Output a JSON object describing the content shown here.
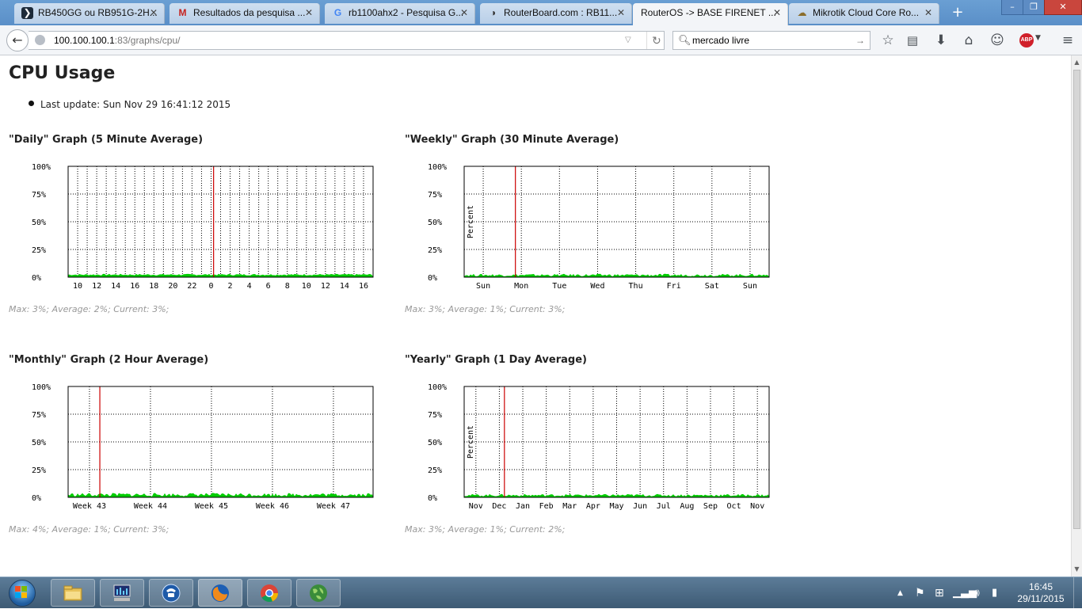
{
  "browser": {
    "tabs": [
      {
        "label": "RB450GG ou RB951G-2H...",
        "icon": "mikrotik-icon",
        "active": false
      },
      {
        "label": "Resultados da pesquisa ...",
        "icon": "gmail-icon",
        "active": false
      },
      {
        "label": "rb1100ahx2 - Pesquisa G...",
        "icon": "google-icon",
        "active": false
      },
      {
        "label": "RouterBoard.com : RB11...",
        "icon": "routerboard-icon",
        "active": false
      },
      {
        "label": "RouterOS -> BASE FIRENET ...",
        "icon": "",
        "active": true
      },
      {
        "label": "Mikrotik Cloud Core Ro...",
        "icon": "cloud-icon",
        "active": false
      }
    ],
    "url_host": "100.100.100.1",
    "url_path": ":83/graphs/cpu/",
    "search_value": "mercado livre",
    "abp_label": "ABP"
  },
  "page": {
    "title": "CPU Usage",
    "last_update": "Last update: Sun Nov 29 16:41:12 2015"
  },
  "graphs": [
    {
      "title": "\"Daily\" Graph (5 Minute Average)",
      "stats": "Max: 3%; Average: 2%; Current: 3%;",
      "ylabel": "",
      "chart_data": {
        "type": "area",
        "y_ticks": [
          "100%",
          "75%",
          "50%",
          "25%",
          "0%"
        ],
        "ylim": [
          0,
          100
        ],
        "x_labels": [
          "10",
          "12",
          "14",
          "16",
          "18",
          "20",
          "22",
          "0",
          "2",
          "4",
          "6",
          "8",
          "10",
          "12",
          "14",
          "16"
        ],
        "grid": true,
        "series_color": "#00cc00",
        "marker_color": "#cc0000",
        "marker_position": 0.477,
        "max": 3,
        "average": 2,
        "current": 3
      }
    },
    {
      "title": "\"Weekly\" Graph (30 Minute Average)",
      "stats": "Max: 3%; Average: 1%; Current: 3%;",
      "ylabel": "Percent",
      "chart_data": {
        "type": "area",
        "y_ticks": [
          "100%",
          "75%",
          "50%",
          "25%",
          "0%"
        ],
        "ylim": [
          0,
          100
        ],
        "x_labels": [
          "Sun",
          "Mon",
          "Tue",
          "Wed",
          "Thu",
          "Fri",
          "Sat",
          "Sun"
        ],
        "grid": true,
        "series_color": "#00cc00",
        "marker_color": "#cc0000",
        "marker_position": 0.168,
        "max": 3,
        "average": 1,
        "current": 3
      }
    },
    {
      "title": "\"Monthly\" Graph (2 Hour Average)",
      "stats": "Max: 4%; Average: 1%; Current: 3%;",
      "ylabel": "",
      "chart_data": {
        "type": "area",
        "y_ticks": [
          "100%",
          "75%",
          "50%",
          "25%",
          "0%"
        ],
        "ylim": [
          0,
          100
        ],
        "x_labels": [
          "Week 43",
          "Week 44",
          "Week 45",
          "Week 46",
          "Week 47"
        ],
        "grid": true,
        "series_color": "#00cc00",
        "marker_color": "#cc0000",
        "marker_position": 0.104,
        "max": 4,
        "average": 1,
        "current": 3
      }
    },
    {
      "title": "\"Yearly\" Graph (1 Day Average)",
      "stats": "Max: 3%; Average: 1%; Current: 2%;",
      "ylabel": "Percent",
      "chart_data": {
        "type": "area",
        "y_ticks": [
          "100%",
          "75%",
          "50%",
          "25%",
          "0%"
        ],
        "ylim": [
          0,
          100
        ],
        "x_labels": [
          "Nov",
          "Dec",
          "Jan",
          "Feb",
          "Mar",
          "Apr",
          "May",
          "Jun",
          "Jul",
          "Aug",
          "Sep",
          "Oct",
          "Nov"
        ],
        "grid": true,
        "series_color": "#00cc00",
        "marker_color": "#cc0000",
        "marker_position": 0.132,
        "max": 3,
        "average": 1,
        "current": 2
      }
    }
  ],
  "taskbar": {
    "clock_time": "16:45",
    "clock_date": "29/11/2015",
    "apps": [
      "explorer-icon",
      "network-monitor-icon",
      "telephone-icon",
      "firefox-icon",
      "chrome-icon",
      "globe-app-icon"
    ]
  }
}
